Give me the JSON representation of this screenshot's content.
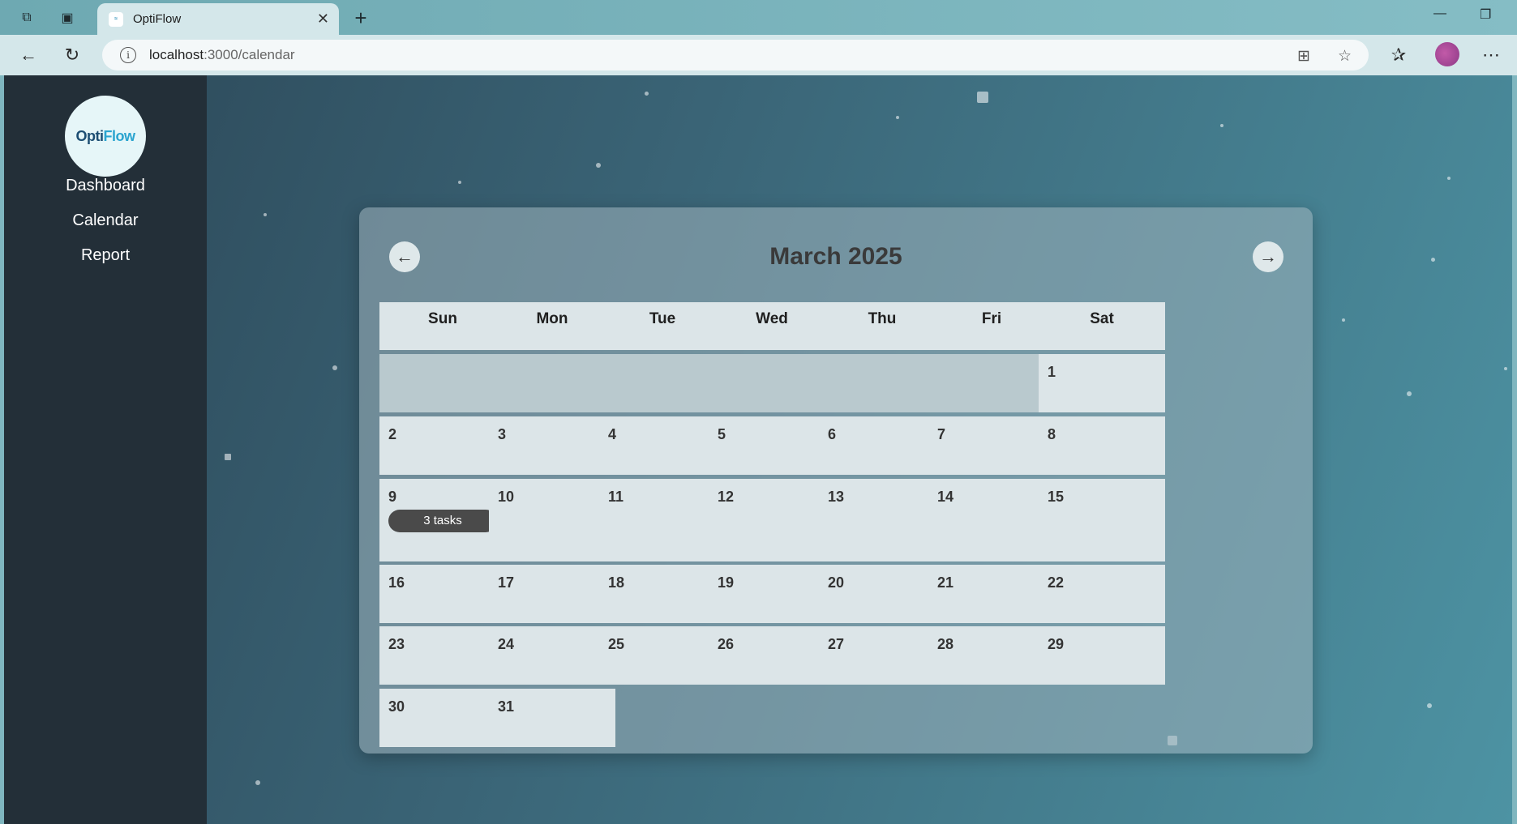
{
  "browser": {
    "tab_title": "OptiFlow",
    "tab_favicon": "optiflow-favicon",
    "url_host": "localhost",
    "url_path": ":3000/calendar"
  },
  "sidebar": {
    "logo_text_a": "Opti",
    "logo_text_b": "Flow",
    "items": [
      {
        "label": "Dashboard"
      },
      {
        "label": "Calendar"
      },
      {
        "label": "Report"
      }
    ]
  },
  "calendar": {
    "title": "March 2025",
    "prev_label": "←",
    "next_label": "→",
    "weekdays": [
      "Sun",
      "Mon",
      "Tue",
      "Wed",
      "Thu",
      "Fri",
      "Sat"
    ],
    "leading_empty_days": 6,
    "days_in_month": 31,
    "tasks": [
      {
        "day": 9,
        "label": "3 tasks"
      }
    ]
  },
  "colors": {
    "sidebar_bg": "#232f38",
    "badge_bg": "#4a4a4a",
    "cell_bg": "#dce5e8"
  }
}
